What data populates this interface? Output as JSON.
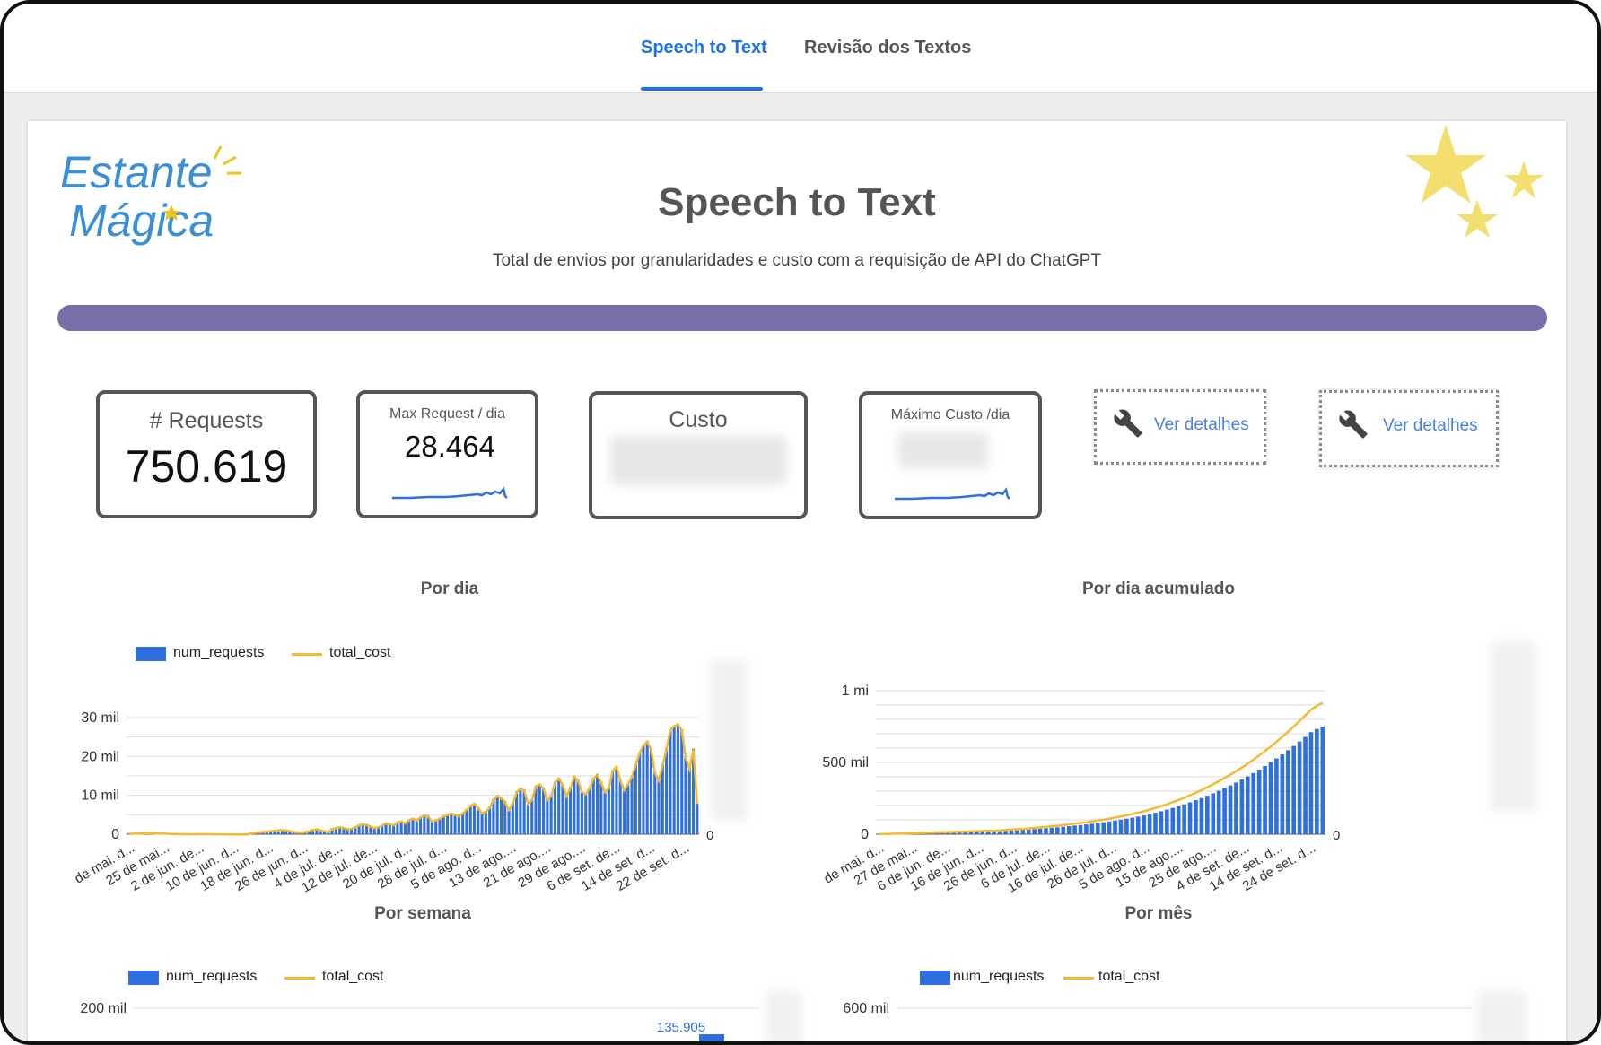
{
  "tabs": [
    {
      "label": "Speech to Text",
      "active": true
    },
    {
      "label": "Revisão dos Textos",
      "active": false
    }
  ],
  "brand": {
    "line1": "Estante",
    "line2": "Mágica"
  },
  "header": {
    "title": "Speech to Text",
    "subtitle": "Total de envios por granularidades e custo com a requisição de API do ChatGPT"
  },
  "colors": {
    "accent": "#1a73e8",
    "bar": "#7a6ea8",
    "series_bar": "#2f6fe0",
    "series_line": "#f5b92e"
  },
  "kpis": {
    "requests_label": "# Requests",
    "requests_value": "750.619",
    "max_request_label": "Max Request / dia",
    "max_request_value": "28.464",
    "custo_label": "Custo",
    "max_custo_label": "Máximo Custo /dia"
  },
  "detail_buttons": [
    {
      "label": "Ver detalhes",
      "icon": "wrench-icon"
    },
    {
      "label": "Ver detalhes",
      "icon": "wrench-icon"
    }
  ],
  "chart_data": [
    {
      "type": "bar",
      "title": "Por dia",
      "legend": [
        "num_requests",
        "total_cost"
      ],
      "legend_position": "top-left",
      "grid": true,
      "ylim": [
        0,
        30000
      ],
      "yticks": [
        "0",
        "10 mil",
        "20 mil",
        "30 mil"
      ],
      "right_axis_ticks": [
        "0"
      ],
      "x_tick_labels": [
        "de mai. d...",
        "25 de mai...",
        "2 de jun. de...",
        "10 de jun. d...",
        "18 de jun. d...",
        "26 de jun. d...",
        "4 de jul. de...",
        "12 de jul. de...",
        "20 de jul. d...",
        "28 de jul. d...",
        "5 de ago. d...",
        "13 de ago....",
        "21 de ago....",
        "29 de ago....",
        "6 de set. de...",
        "14 de set. d...",
        "22 de set. d..."
      ],
      "series": [
        {
          "name": "num_requests",
          "values": [
            300,
            350,
            400,
            420,
            450,
            500,
            480,
            400,
            420,
            380,
            350,
            300,
            280,
            260,
            240,
            220,
            200,
            210,
            230,
            250,
            240,
            220,
            210,
            200,
            190,
            180,
            170,
            160,
            150,
            140,
            150,
            160,
            500,
            600,
            700,
            800,
            900,
            1000,
            1100,
            1200,
            1300,
            1200,
            1000,
            800,
            700,
            600,
            800,
            1000,
            1300,
            1500,
            1200,
            1000,
            800,
            1500,
            1800,
            2000,
            1800,
            1500,
            1600,
            2000,
            2500,
            2800,
            2600,
            2200,
            1800,
            2000,
            2400,
            3000,
            2800,
            2500,
            3200,
            3500,
            3000,
            3800,
            4200,
            3800,
            4500,
            5000,
            4800,
            3500,
            3800,
            4200,
            4800,
            5200,
            5500,
            5200,
            4800,
            5500,
            6500,
            7500,
            8000,
            7000,
            5500,
            6000,
            7000,
            9000,
            10000,
            9500,
            8500,
            6500,
            8000,
            11000,
            12000,
            11500,
            8000,
            9000,
            12500,
            13000,
            12000,
            9000,
            10000,
            13500,
            14500,
            13000,
            10000,
            12000,
            15000,
            14000,
            11000,
            10500,
            12000,
            14500,
            15500,
            13500,
            11000,
            12000,
            16500,
            17500,
            14000,
            11500,
            13000,
            15000,
            18000,
            21000,
            23000,
            24000,
            22000,
            16000,
            14000,
            18000,
            22000,
            27000,
            28000,
            28464,
            27000,
            20000,
            17000,
            22000,
            8000
          ]
        },
        {
          "name": "total_cost",
          "values": []
        }
      ]
    },
    {
      "type": "bar",
      "title": "Por dia acumulado",
      "legend_position": "none",
      "grid": true,
      "ylim": [
        0,
        1000000
      ],
      "yticks": [
        "0",
        "500 mil",
        "1 mi"
      ],
      "right_axis_ticks": [
        "0"
      ],
      "x_tick_labels": [
        "de mai. d...",
        "27 de mai...",
        "6 de jun. de...",
        "16 de jun. d...",
        "26 de jun. d...",
        "6 de jul. de...",
        "16 de jul. de...",
        "26 de jul. d...",
        "5 de ago. d...",
        "15 de ago....",
        "25 de ago....",
        "4 de set. de...",
        "14 de set. d...",
        "24 de set. d..."
      ],
      "series": [
        {
          "name": "num_requests",
          "values": [
            0,
            1000,
            2000,
            3000,
            4000,
            5000,
            6000,
            7000,
            8000,
            9000,
            10000,
            11000,
            12000,
            13000,
            14000,
            15000,
            16000,
            17000,
            18000,
            19000,
            20000,
            22000,
            24000,
            26000,
            28000,
            30000,
            33000,
            36000,
            39000,
            42000,
            45000,
            48000,
            52000,
            56000,
            60000,
            64000,
            68000,
            73000,
            78000,
            83000,
            89000,
            95000,
            101000,
            108000,
            115000,
            123000,
            131000,
            140000,
            150000,
            160000,
            171000,
            183000,
            195000,
            208000,
            222000,
            237000,
            252000,
            268000,
            285000,
            303000,
            321000,
            340000,
            360000,
            381000,
            403000,
            426000,
            450000,
            475000,
            501000,
            528000,
            556000,
            585000,
            615000,
            646000,
            678000,
            711000,
            733000,
            750619
          ]
        }
      ]
    },
    {
      "type": "bar",
      "title": "Por semana",
      "legend": [
        "num_requests",
        "total_cost"
      ],
      "legend_position": "top-left",
      "yticks": [
        "200 mil"
      ],
      "data_labels": [
        "135.905"
      ]
    },
    {
      "type": "bar",
      "title": "Por mês",
      "legend": [
        "num_requests",
        "total_cost"
      ],
      "legend_position": "top-left",
      "yticks": [
        "600 mil"
      ]
    }
  ]
}
